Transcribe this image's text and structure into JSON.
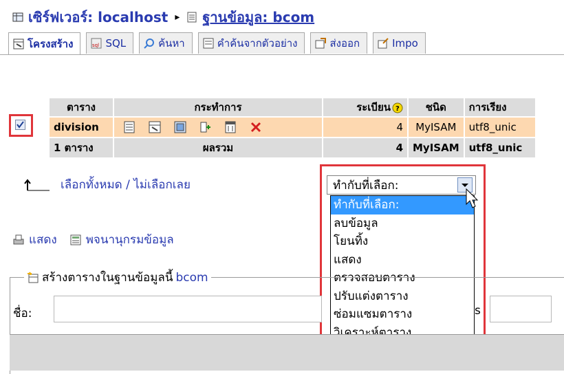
{
  "breadcrumb": {
    "server_label": "เซิร์ฟเวอร์: localhost",
    "separator": "▸",
    "db_label": "ฐานข้อมูล: bcom"
  },
  "tabs": [
    {
      "label": "โครงสร้าง",
      "icon": "structure-icon",
      "active": true
    },
    {
      "label": "SQL",
      "icon": "sql-icon",
      "active": false
    },
    {
      "label": "ค้นหา",
      "icon": "search-icon",
      "active": false
    },
    {
      "label": "คำค้นจากตัวอย่าง",
      "icon": "query-icon",
      "active": false
    },
    {
      "label": "ส่งออก",
      "icon": "export-icon",
      "active": false
    },
    {
      "label": "Impo",
      "icon": "import-icon",
      "active": false
    }
  ],
  "table": {
    "headers": {
      "table": "ตาราง",
      "actions": "กระทำการ",
      "records": "ระเบียน",
      "type": "ชนิด",
      "collation": "การเรียง"
    },
    "row": {
      "checked": true,
      "name": "division",
      "records": "4",
      "type": "MyISAM",
      "collation": "utf8_unic"
    },
    "summary": {
      "count": "1 ตาราง",
      "label": "ผลรวม",
      "records": "4",
      "type": "MyISAM",
      "collation": "utf8_unic"
    }
  },
  "select_all": {
    "check_all": "เลือกทั้งหมด",
    "divider": "/",
    "uncheck_all": "ไม่เลือกเลย"
  },
  "with_selected": {
    "value": "ทำกับที่เลือก:",
    "options": [
      "ทำกับที่เลือก:",
      "ลบข้อมูล",
      "โยนทิ้ง",
      "แสดง",
      "ตรวจสอบตาราง",
      "ปรับแต่งตาราง",
      "ซ่อมแซมตาราง",
      "วิเคราะห์ตาราง"
    ]
  },
  "bottom_links": {
    "print_view": "แสดง",
    "data_dictionary": "พจนานุกรมข้อมูล"
  },
  "create_table": {
    "legend_prefix": "สร้างตารางในฐานข้อมูลนี้",
    "db_name": "bcom",
    "name_label": "ชื่อ:",
    "fields_label_fragment": "s"
  },
  "colors": {
    "link": "#2a3bb0",
    "highlight": "#e0353a",
    "row_bg": "#fdd8b0",
    "header_bg": "#dcdcdc",
    "selected_option": "#3399ff"
  }
}
